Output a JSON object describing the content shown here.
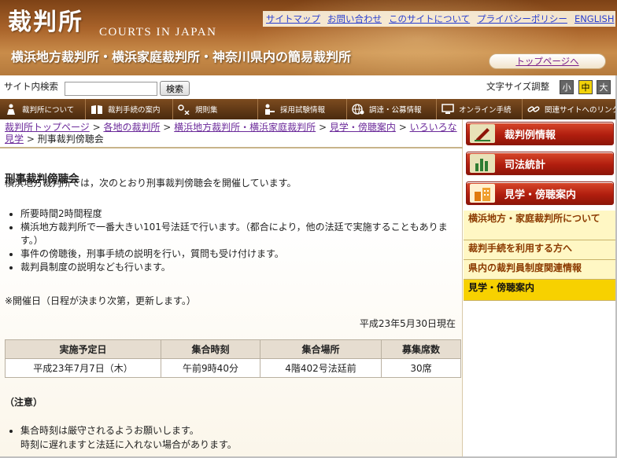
{
  "header": {
    "logo_kanji": "裁判所",
    "logo_en": "COURTS IN JAPAN",
    "court_title": "横浜地方裁判所・横浜家庭裁判所・神奈川県内の簡易裁判所",
    "top_page_link": "トップページへ",
    "nav_links": [
      "サイトマップ",
      "お問い合わせ",
      "このサイトについて",
      "プライバシーポリシー",
      "ENGLISH"
    ]
  },
  "search": {
    "label": "サイト内検索",
    "value": "",
    "button": "検索"
  },
  "font_size": {
    "label": "文字サイズ調整",
    "small": "小",
    "medium": "中",
    "large": "大"
  },
  "global_nav": [
    {
      "label": "裁判所について",
      "icon": "person-icon"
    },
    {
      "label": "裁判手続の案内",
      "icon": "book-icon"
    },
    {
      "label": "規則集",
      "icon": "scale-icon"
    },
    {
      "label": "採用試験情報",
      "icon": "person-desk-icon"
    },
    {
      "label": "調達・公募情報",
      "icon": "globe-icon"
    },
    {
      "label": "オンライン手続",
      "icon": "monitor-icon"
    },
    {
      "label": "関連サイトへのリンク",
      "icon": "link-icon"
    }
  ],
  "breadcrumb": {
    "items": [
      "裁判所トップページ",
      "各地の裁判所",
      "横浜地方裁判所・横浜家庭裁判所",
      "見学・傍聴案内",
      "いろいろな見学"
    ],
    "current": "刑事裁判傍聴会"
  },
  "main": {
    "title": "刑事裁判傍聴会",
    "intro": "横浜地方裁判所では，次のとおり刑事裁判傍聴会を開催しています。",
    "bullets": [
      "所要時間2時間程度",
      "横浜地方裁判所で一番大きい101号法廷で行います。（都合により，他の法廷で実施することもあります。）",
      "事件の傍聴後，刑事手続の説明を行い，質問も受け付けます。",
      "裁判員制度の説明なども行います。"
    ],
    "date_note": "※開催日（日程が決まり次第，更新します。）",
    "as_of": "平成23年5月30日現在",
    "table": {
      "headers": [
        "実施予定日",
        "集合時刻",
        "集合場所",
        "募集席数"
      ],
      "rows": [
        [
          "平成23年7月7日（木）",
          "午前9時40分",
          "4階402号法廷前",
          "30席"
        ]
      ]
    },
    "caution_title": "（注意）",
    "caution_bullets": [
      "集合時刻は厳守されるようお願いします。\n時刻に遅れますと法廷に入れない場合があります。"
    ]
  },
  "sidebar": {
    "buttons": [
      {
        "label": "裁判例情報",
        "icon": "pen-icon"
      },
      {
        "label": "司法統計",
        "icon": "bar-chart-icon"
      },
      {
        "label": "見学・傍聴案内",
        "icon": "building-icon"
      }
    ],
    "links": [
      "横浜地方・家庭裁判所について",
      "裁判手続を利用する方へ",
      "県内の裁判員制度関連情報",
      "見学・傍聴案内"
    ]
  }
}
